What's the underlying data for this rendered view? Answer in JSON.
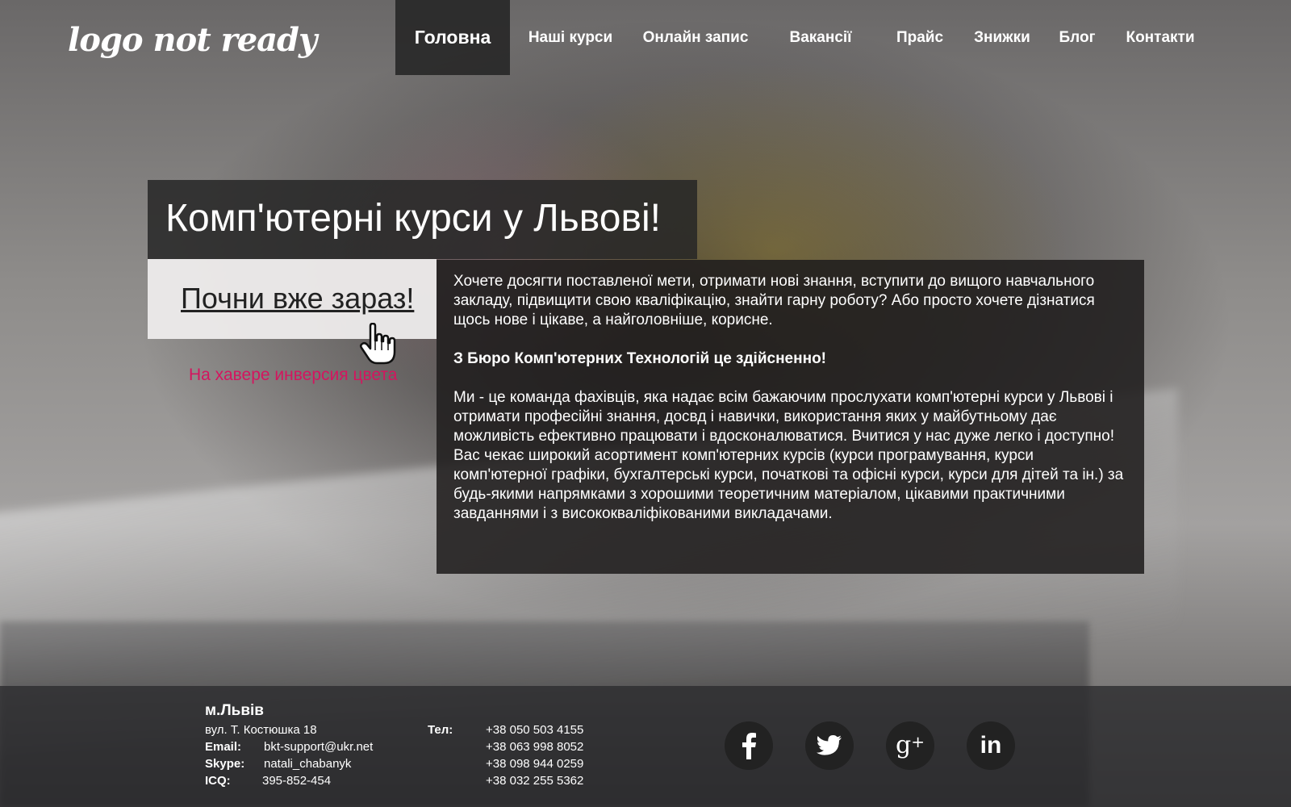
{
  "logo": {
    "text": "logo not ready"
  },
  "nav": {
    "items": [
      {
        "label": "Головна"
      },
      {
        "label": "Наші курси"
      },
      {
        "label": "Онлайн запис"
      },
      {
        "label": "Вакансії"
      },
      {
        "label": "Прайс"
      },
      {
        "label": "Знижки"
      },
      {
        "label": "Блог"
      },
      {
        "label": "Контакти"
      }
    ]
  },
  "hero": {
    "title": "Комп'ютерні курси у Львові!",
    "cta_label": "Почни вже зараз!",
    "hover_note": "На хавере инверсия цвета",
    "hover_note_color": "#d4155f"
  },
  "content": {
    "p1": "Хочете досягти поставленої мети, отримати нові знання, вступити до вищого навчального закладу, підвищити свою кваліфікацію, знайти гарну роботу? Або просто хочете дізнатися щось нове і цікаве, а найголовніше, корисне.",
    "p2": "З Бюро Комп'ютерних Технологій це здійсненно!",
    "p3": "Ми - це команда фахівців, яка надає всім бажаючим прослухати комп'ютерні курси у Львові і отримати професійні знання, досвд і навички, використання яких у майбутньому дає можливість ефективно працювати і вдосконалюватися. Вчитися у нас дуже легко і доступно!",
    "p4": "Вас чекає широкий асортимент комп'ютерних курсів (курси програмування, курси комп'ютерної графіки, бухгалтерські курси, початкові та офісні курси, курси для дітей та ін.) за будь-якими напрямками з хорошими теоретичним матеріалом, цікавими практичними завданнями і з висококваліфікованими викладачами."
  },
  "footer": {
    "city": "м.Львів",
    "address": "вул. Т. Костюшка 18",
    "email_label": "Email:",
    "email": "bkt-support@ukr.net",
    "skype_label": "Skype:",
    "skype": "natali_chabanyk",
    "icq_label": "ICQ:",
    "icq": "395-852-454",
    "tel_label": "Тел:",
    "phones": [
      "+38 050 503 4155",
      "+38 063 998 8052",
      "+38 098 944 0259",
      "+38 032 255 5362"
    ]
  },
  "social": [
    "facebook-icon",
    "twitter-icon",
    "google-plus-icon",
    "linkedin-icon"
  ]
}
